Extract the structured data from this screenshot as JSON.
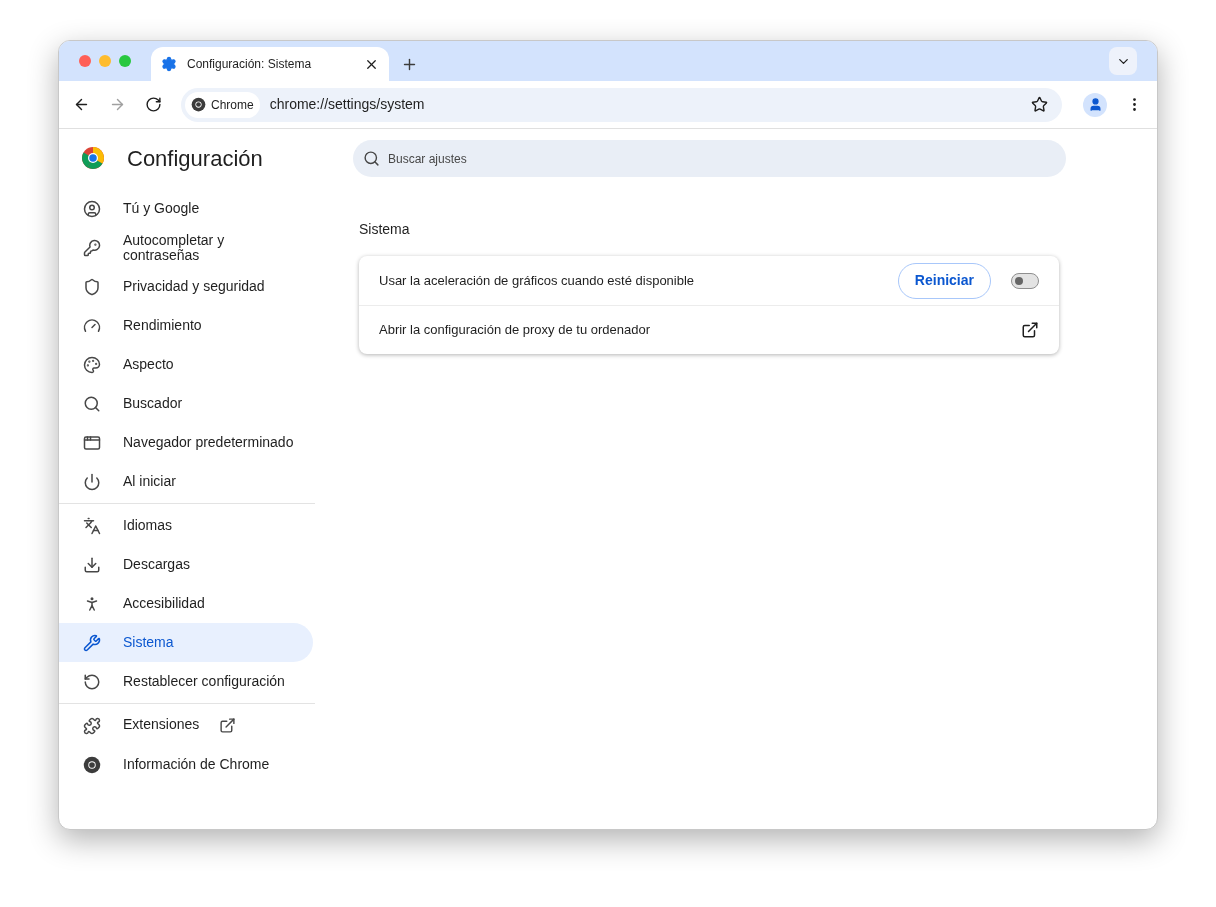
{
  "tabs": [
    {
      "title": "Configuración: Sistema",
      "selected": true
    }
  ],
  "nav_buttons": [
    {
      "disabled": false
    },
    {
      "disabled": true
    },
    {
      "disabled": false
    }
  ],
  "address_bar": {
    "chip": "Chrome",
    "url": "chrome://settings/system"
  },
  "header": {
    "title": "Configuración",
    "search_placeholder": "Buscar ajustes"
  },
  "sidebar": {
    "groups": [
      {
        "items": [
          {
            "label": "Tú y Google",
            "kind": "page",
            "selected": false
          },
          {
            "label": "Autocompletar y contraseñas",
            "kind": "page",
            "selected": false
          },
          {
            "label": "Privacidad y seguridad",
            "kind": "page",
            "selected": false
          },
          {
            "label": "Rendimiento",
            "kind": "page",
            "selected": false
          },
          {
            "label": "Aspecto",
            "kind": "page",
            "selected": false
          },
          {
            "label": "Buscador",
            "kind": "page",
            "selected": false
          },
          {
            "label": "Navegador predeterminado",
            "kind": "page",
            "selected": false
          },
          {
            "label": "Al iniciar",
            "kind": "page",
            "selected": false
          }
        ]
      },
      {
        "items": [
          {
            "label": "Idiomas",
            "kind": "page",
            "selected": false
          },
          {
            "label": "Descargas",
            "kind": "page",
            "selected": false
          },
          {
            "label": "Accesibilidad",
            "kind": "page",
            "selected": false
          },
          {
            "label": "Sistema",
            "kind": "page",
            "selected": true
          },
          {
            "label": "Restablecer configuración",
            "kind": "page",
            "selected": false
          }
        ]
      },
      {
        "items": [
          {
            "label": "Extensiones",
            "kind": "link",
            "selected": false
          },
          {
            "label": "Información de Chrome",
            "kind": "page",
            "selected": false
          }
        ]
      }
    ]
  },
  "section": {
    "title": "Sistema",
    "rows": [
      {
        "label": "Usar la aceleración de gráficos cuando esté disponible",
        "kind": "toggle",
        "button": "Reiniciar",
        "on": false
      },
      {
        "label": "Abrir la configuración de proxy de tu ordenador",
        "kind": "link"
      }
    ]
  }
}
